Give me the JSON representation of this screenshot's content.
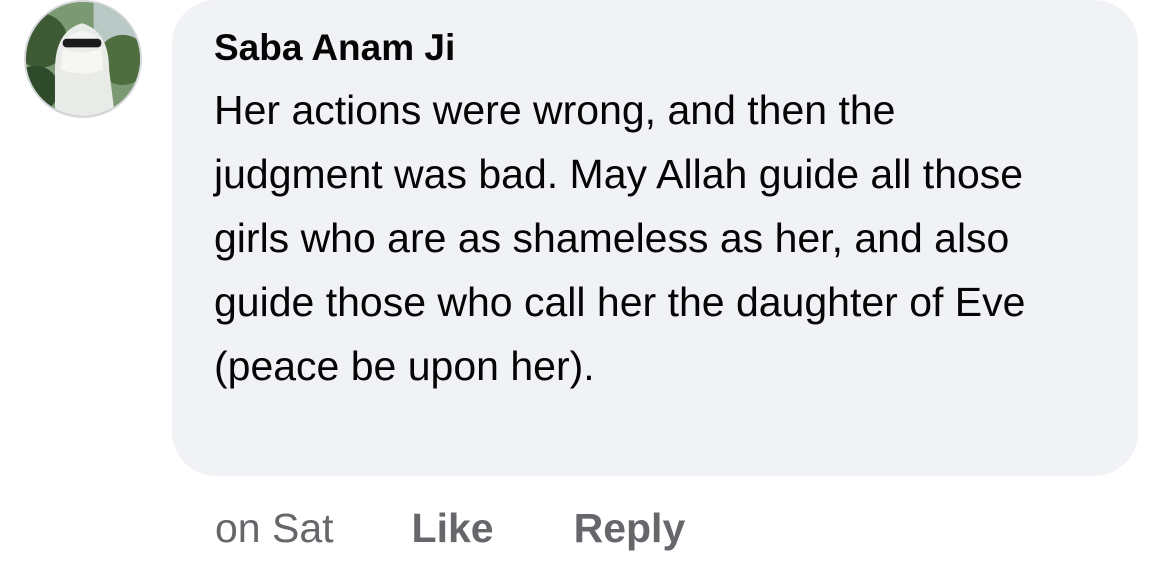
{
  "comment": {
    "author": "Saba Anam Ji",
    "text": "Her actions were wrong, and then the judgment was bad. May Allah guide all those girls who are as shameless as her, and also guide those who call her the daughter of Eve (peace be upon her).",
    "timestamp": "on Sat",
    "like_label": "Like",
    "reply_label": "Reply"
  },
  "avatar": {
    "icon": "profile-photo-veiled-person"
  },
  "colors": {
    "bubble_bg": "#f0f2f5",
    "text_primary": "#050505",
    "text_secondary": "#65676b"
  }
}
